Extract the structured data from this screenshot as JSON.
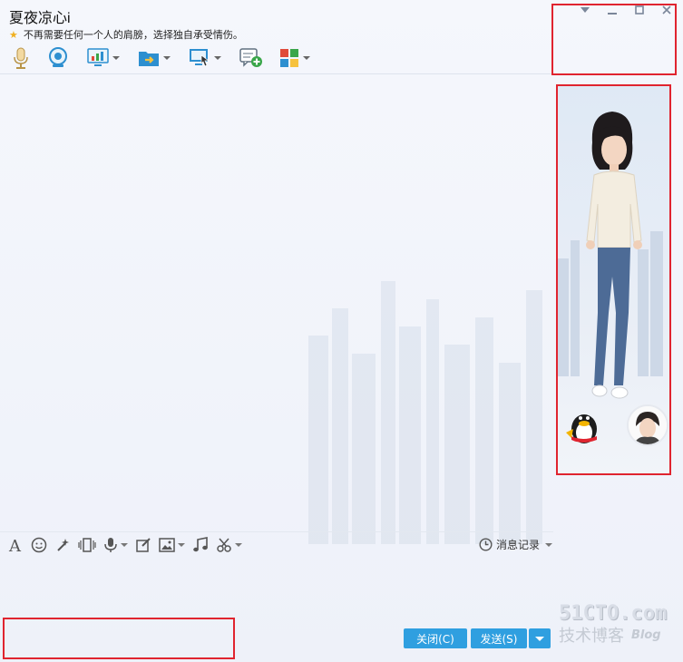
{
  "window": {
    "title": "夏夜凉心i",
    "signature": "不再需要任何一个人的肩膀，选择独自承受情伤。"
  },
  "toolbar": {
    "items": [
      {
        "name": "voice-call",
        "icon": "microphone-icon"
      },
      {
        "name": "video-call",
        "icon": "webcam-icon"
      },
      {
        "name": "remote-desktop",
        "icon": "monitor-chart-icon"
      },
      {
        "name": "send-file",
        "icon": "folder-arrow-icon"
      },
      {
        "name": "screen-share",
        "icon": "screen-cursor-icon"
      },
      {
        "name": "create-discussion",
        "icon": "chat-add-icon"
      },
      {
        "name": "apps",
        "icon": "app-grid-icon"
      }
    ]
  },
  "input_toolbar": {
    "message_record_label": "消息记录"
  },
  "buttons": {
    "close_label": "关闭(C)",
    "send_label": "发送(S)"
  },
  "watermark": {
    "main": "51CTO.com",
    "sub": "技术博客",
    "blog": "Blog"
  },
  "colors": {
    "accent": "#2f9fe0",
    "highlight_box": "#e0242f",
    "star": "#f0b020"
  }
}
